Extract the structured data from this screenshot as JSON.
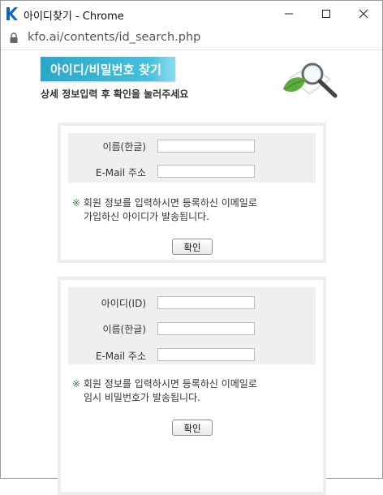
{
  "window": {
    "title": "아이디찾기 - Chrome",
    "url": "kfo.ai/contents/id_search.php"
  },
  "page": {
    "heading": "아이디/비밀번호 찾기",
    "subtitle": "상세 정보입력 후 확인을 눌러주세요"
  },
  "id_search": {
    "name_label": "이름(한글)",
    "email_label": "E-Mail 주소",
    "name_value": "",
    "email_value": "",
    "notice_mark": "※",
    "notice_line1": "회원 정보를 입력하시면 등록하신 이메일로",
    "notice_line2": "가입하신 아이디가 발송됩니다.",
    "confirm_label": "확인"
  },
  "pw_search": {
    "id_label": "아이디(ID)",
    "name_label": "이름(한글)",
    "email_label": "E-Mail 주소",
    "id_value": "",
    "name_value": "",
    "email_value": "",
    "notice_mark": "※",
    "notice_line1": "회원 정보를 입력하시면 등록하신 이메일로",
    "notice_line2": "임시 비밀번호가 발송됩니다.",
    "confirm_label": "확인"
  },
  "icons": {
    "app": "kfo-logo-icon",
    "minimize": "minimize-icon",
    "maximize": "maximize-icon",
    "close": "close-icon",
    "lock": "lock-icon",
    "illustration": "magnifier-leaf-illustration"
  },
  "colors": {
    "accent": "#2aa8c8",
    "panel_border": "#eeeeee",
    "fieldset_bg": "#efefef",
    "logo_blue": "#1565c0",
    "leaf_green": "#5cab3c"
  }
}
